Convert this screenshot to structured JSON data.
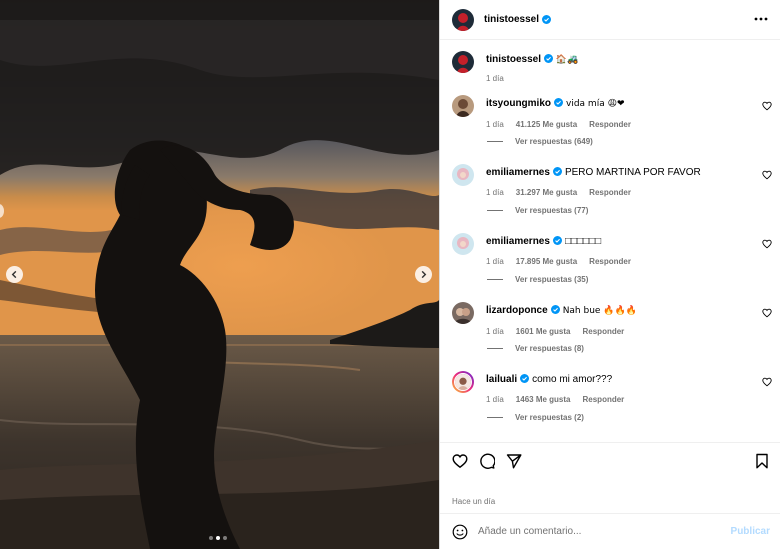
{
  "post": {
    "username": "tinistoessel",
    "caption_emojis": "🏠🚜",
    "caption_time": "1 día",
    "carousel": {
      "total": 3,
      "active": 1
    }
  },
  "icons": {
    "more": "more-horizontal-icon",
    "verified": "verified-badge-icon",
    "like": "heart-icon",
    "comment": "comment-bubble-icon",
    "share": "paper-plane-icon",
    "save": "bookmark-icon",
    "emoji": "smiley-icon"
  },
  "colors": {
    "verified": "#0095f6",
    "heart_red": "#ed4956",
    "link_muted": "#737373",
    "publish_disabled": "#b3dbff"
  },
  "comments": [
    {
      "username": "itsyoungmiko",
      "text": "vida mía 😩❤",
      "time": "1 día",
      "likes": "41.125 Me gusta",
      "reply": "Responder",
      "replies": "Ver respuestas (649)"
    },
    {
      "username": "emiliamernes",
      "text": "PERO MARTINA POR FAVOR",
      "time": "1 día",
      "likes": "31.297 Me gusta",
      "reply": "Responder",
      "replies": "Ver respuestas (77)"
    },
    {
      "username": "emiliamernes",
      "text": "□□□□□□",
      "time": "1 día",
      "likes": "17.895 Me gusta",
      "reply": "Responder",
      "replies": "Ver respuestas (35)"
    },
    {
      "username": "lizardoponce",
      "text": "Nah bue 🔥🔥🔥",
      "time": "1 día",
      "likes": "1601 Me gusta",
      "reply": "Responder",
      "replies": "Ver respuestas (8)"
    },
    {
      "username": "lailuali",
      "text": "como mi amor???",
      "time": "1 día",
      "likes": "1463 Me gusta",
      "reply": "Responder",
      "replies": "Ver respuestas (2)"
    }
  ],
  "footer": {
    "timestamp": "Hace un día",
    "input_placeholder": "Añade un comentario...",
    "publish_label": "Publicar"
  }
}
